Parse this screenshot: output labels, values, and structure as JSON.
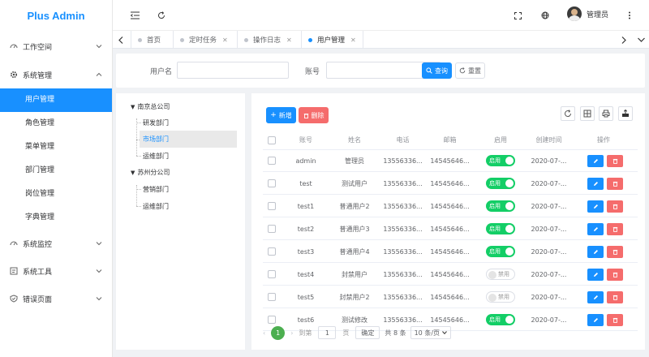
{
  "app": {
    "title": "Plus Admin",
    "brand_color": "#1890ff"
  },
  "sidebar": {
    "groups": [
      {
        "label": "工作空间",
        "icon": "dashboard-icon"
      },
      {
        "label": "系统管理",
        "icon": "gear-icon",
        "children": [
          "用户管理",
          "角色管理",
          "菜单管理",
          "部门管理",
          "岗位管理",
          "字典管理"
        ]
      },
      {
        "label": "系统监控",
        "icon": "monitor-icon"
      },
      {
        "label": "系统工具",
        "icon": "tools-icon"
      },
      {
        "label": "错误页面",
        "icon": "shield-check-icon"
      }
    ],
    "active_child": "用户管理"
  },
  "header": {
    "user_name": "管理员"
  },
  "tabs": [
    {
      "label": "首页",
      "closable": false
    },
    {
      "label": "定时任务",
      "closable": true
    },
    {
      "label": "操作日志",
      "closable": true
    },
    {
      "label": "用户管理",
      "closable": true,
      "active": true
    }
  ],
  "search": {
    "username_label": "用户名",
    "account_label": "账号",
    "query_label": "查询",
    "reset_label": "重置"
  },
  "tree": {
    "nodes": [
      {
        "label": "南京总公司",
        "level": 0
      },
      {
        "label": "研发部门",
        "level": 1
      },
      {
        "label": "市场部门",
        "level": 1,
        "selected": true
      },
      {
        "label": "运维部门",
        "level": 1
      },
      {
        "label": "苏州分公司",
        "level": 0
      },
      {
        "label": "营销部门",
        "level": 1
      },
      {
        "label": "运维部门",
        "level": 1
      }
    ]
  },
  "toolbar": {
    "add_label": "新增",
    "delete_label": "删除"
  },
  "table": {
    "columns": [
      "账号",
      "姓名",
      "电话",
      "邮箱",
      "启用",
      "创建时间",
      "操作"
    ],
    "rows": [
      {
        "account": "admin",
        "name": "管理员",
        "phone": "13556336...",
        "email": "14545646...",
        "enabled": true,
        "created": "2020-07-..."
      },
      {
        "account": "test",
        "name": "测试用户",
        "phone": "13556336...",
        "email": "14545646...",
        "enabled": true,
        "created": "2020-07-..."
      },
      {
        "account": "test1",
        "name": "普通用户2",
        "phone": "13556336...",
        "email": "14545646...",
        "enabled": true,
        "created": "2020-07-..."
      },
      {
        "account": "test2",
        "name": "普通用户3",
        "phone": "13556336...",
        "email": "14545646...",
        "enabled": true,
        "created": "2020-07-..."
      },
      {
        "account": "test3",
        "name": "普通用户4",
        "phone": "13556336...",
        "email": "14545646...",
        "enabled": true,
        "created": "2020-07-..."
      },
      {
        "account": "test4",
        "name": "封禁用户",
        "phone": "13556336...",
        "email": "14545646...",
        "enabled": false,
        "created": "2020-07-..."
      },
      {
        "account": "test5",
        "name": "封禁用户2",
        "phone": "13556336...",
        "email": "14545646...",
        "enabled": false,
        "created": "2020-07-..."
      },
      {
        "account": "test6",
        "name": "测试修改",
        "phone": "13556336...",
        "email": "14545646...",
        "enabled": true,
        "created": "2020-07-..."
      }
    ],
    "switch_on_label": "启用",
    "switch_off_label": "禁用"
  },
  "pagination": {
    "current_page": "1",
    "goto_label": "到第",
    "goto_value": "1",
    "page_unit": "页",
    "confirm_label": "确定",
    "total_label": "共 8 条",
    "page_size_label": "10 条/页"
  }
}
